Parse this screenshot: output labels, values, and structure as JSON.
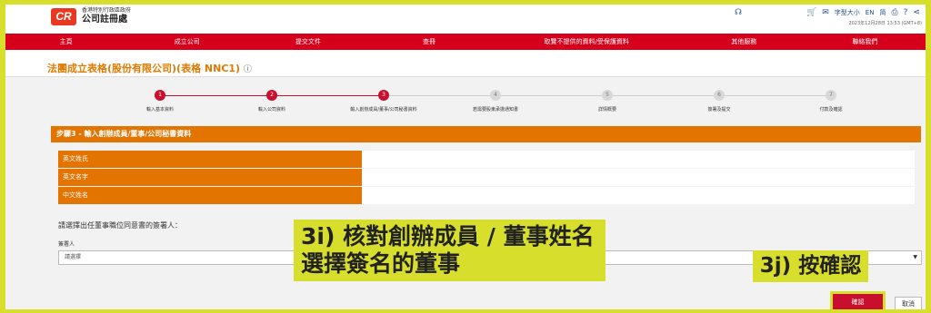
{
  "header": {
    "logo": "CR",
    "gov_line": "香港特別行政區政府",
    "office": "公司註冊處",
    "font_size_label": "字型大小",
    "lang_en": "EN",
    "lang_tc": "简",
    "datetime": "2023年12月28日 13:53 (GMT+8)"
  },
  "nav": [
    "主頁",
    "成立公司",
    "提交文件",
    "查冊",
    "取覽不提供的資料/受保護資料",
    "其他服務",
    "聯絡我們"
  ],
  "page_title": "法團成立表格(股份有限公司)(表格 NNC1)",
  "steps": [
    {
      "num": "1",
      "label": "輸入基本資料",
      "done": true
    },
    {
      "num": "2",
      "label": "輸入公司資料",
      "done": true
    },
    {
      "num": "3",
      "label": "輸入創辦成員/董事/公司秘書資料",
      "done": true
    },
    {
      "num": "4",
      "label": "若需要股東承擔通知書",
      "done": false
    },
    {
      "num": "5",
      "label": "詳情概要",
      "done": false
    },
    {
      "num": "6",
      "label": "簽署及提交",
      "done": false
    },
    {
      "num": "7",
      "label": "付款及確認",
      "done": false
    }
  ],
  "section_title": "步驟3 - 輸入創辦成員/董事/公司秘書資料",
  "fields": [
    "英文姓氏",
    "英文名字",
    "中文姓名"
  ],
  "signer_question": "請選擇出任董事職位同意書的簽署人：",
  "signer_label": "簽署人",
  "select_placeholder": "請選擇",
  "confirm_label": "確認",
  "cancel_label": "取消",
  "annotation1_line1": "3i) 核對創辦成員 / 董事姓名",
  "annotation1_line2": "選擇簽名的董事",
  "annotation2": "3j) 按確認",
  "colors": {
    "brand_red": "#d6001c",
    "orange": "#e47400",
    "highlight": "#d7de2c"
  }
}
